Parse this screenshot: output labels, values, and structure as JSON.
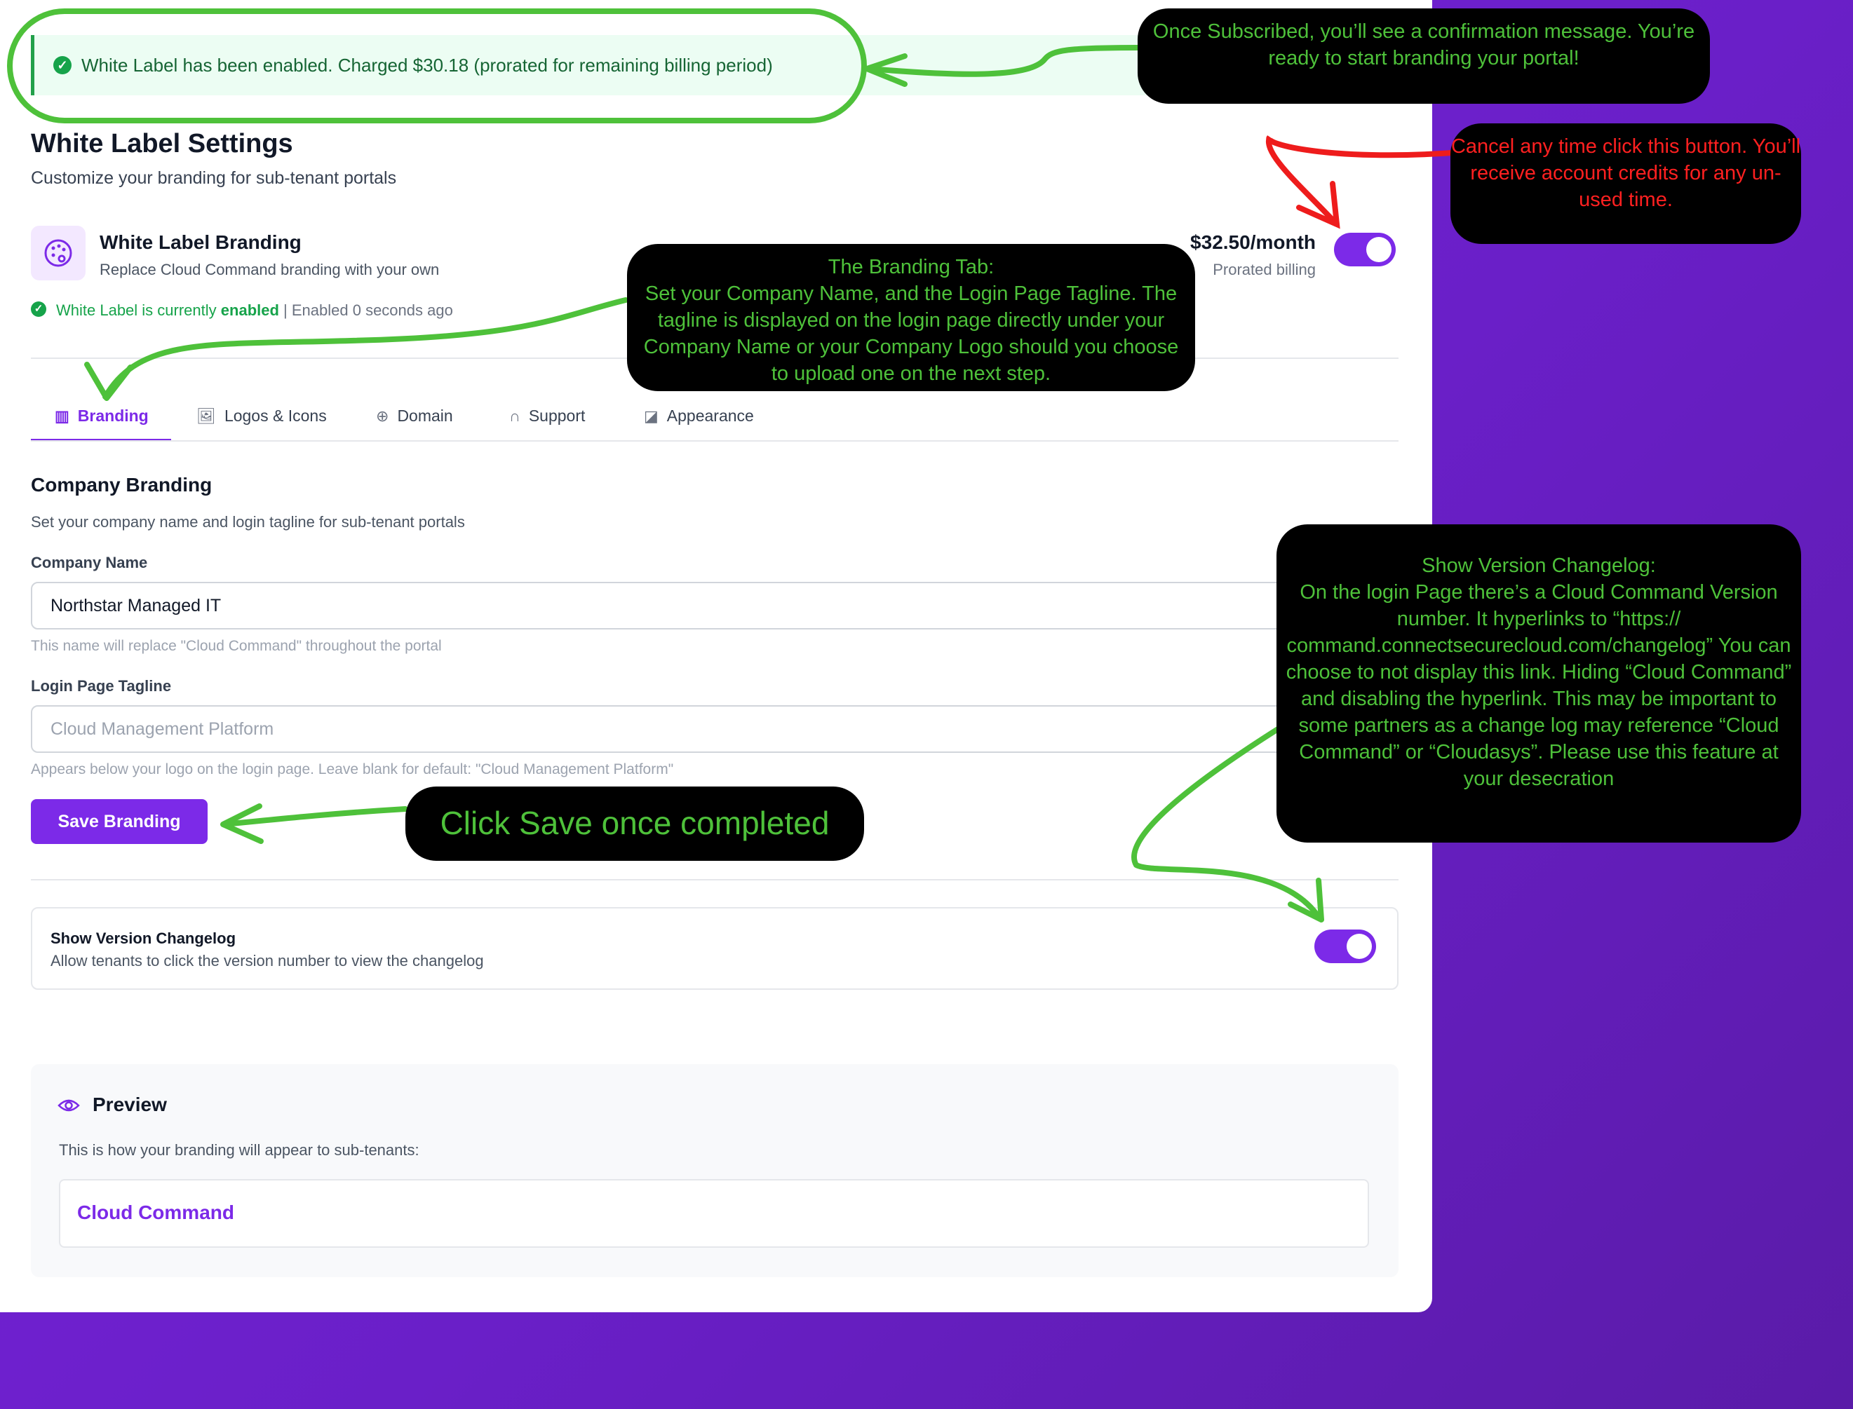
{
  "banner": {
    "message": "White Label has been enabled. Charged $30.18 (prorated for remaining billing period)"
  },
  "header": {
    "title": "White Label Settings",
    "subtitle": "Customize your branding for sub-tenant portals"
  },
  "feature": {
    "title": "White Label Branding",
    "description": "Replace Cloud Command branding with your own",
    "price": "$32.50/month",
    "billing": "Prorated billing",
    "status_prefix": "White Label is currently",
    "status_word": "enabled",
    "status_time": "| Enabled 0 seconds ago",
    "toggle_on": true
  },
  "tabs": [
    {
      "label": "Branding",
      "icon": "building-icon",
      "active": true
    },
    {
      "label": "Logos & Icons",
      "icon": "image-icon"
    },
    {
      "label": "Domain",
      "icon": "globe-icon"
    },
    {
      "label": "Support",
      "icon": "headset-icon"
    },
    {
      "label": "Appearance",
      "icon": "palette-icon"
    }
  ],
  "branding": {
    "section_title": "Company Branding",
    "section_desc": "Set your company name and login tagline for sub-tenant portals",
    "company_label": "Company Name",
    "company_value": "Northstar Managed IT",
    "company_hint": "This name will replace \"Cloud Command\" throughout the portal",
    "tagline_label": "Login Page Tagline",
    "tagline_placeholder": "Cloud Management Platform",
    "tagline_hint": "Appears below your logo on the login page. Leave blank for default: \"Cloud Management Platform\"",
    "save_label": "Save Branding"
  },
  "changelog": {
    "title": "Show Version Changelog",
    "description": "Allow tenants to click the version number to view the changelog",
    "toggle_on": true
  },
  "preview": {
    "title": "Preview",
    "description": "This is how your branding will appear to sub-tenants:",
    "brand_name": "Cloud Command"
  },
  "callouts": {
    "confirmation": "Once Subscribed, you’ll see a confirmation message. You’re ready to start branding your portal!",
    "cancel": "Cancel any time click this button. You’ll receive account credits for any un-used time.",
    "branding_tab": "The Branding Tab:\nSet your Company Name, and the Login Page Tagline. The tagline is displayed on the login page directly under your Company Name or your Company Logo should you choose to upload one on the next step.",
    "save": "Click Save once completed",
    "changelog": "Show Version Changelog:\nOn the login Page there’s a Cloud Command Version number. It hyperlinks to “https:// command.connectsecurecloud.com/changelog” You can choose to not display this link. Hiding “Cloud Command” and disabling the hyperlink. This may be important to some partners as a change log may reference “Cloud Command” or “Cloudasys”. Please use this feature at your desecration"
  },
  "colors": {
    "accent": "#7c2ae8",
    "success": "#16a34a",
    "annotation_green": "#4ec13a",
    "annotation_red": "#ff2020"
  }
}
